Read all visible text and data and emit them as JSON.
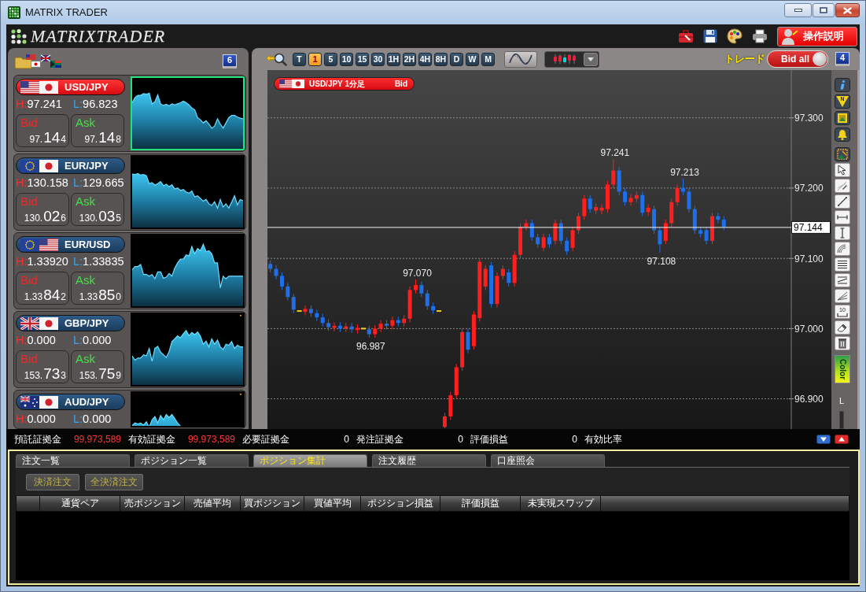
{
  "window": {
    "title": "MATRIX TRADER"
  },
  "app_bar": {
    "logo": "MATRIXTRADER",
    "help_button": "操作説明"
  },
  "rate_panel": {
    "screen_number": "6",
    "pairs": [
      {
        "pair": "USD/JPY",
        "selected": true,
        "high_label": "H:",
        "high": "97.241",
        "low_label": "L:",
        "low": "96.823",
        "bid_label": "Bid",
        "bid": {
          "prefix": "97.",
          "pips": "14",
          "pipette": "4"
        },
        "ask_label": "Ask",
        "ask": {
          "prefix": "97.",
          "pips": "14",
          "pipette": "8"
        }
      },
      {
        "pair": "EUR/JPY",
        "selected": false,
        "high_label": "H:",
        "high": "130.158",
        "low_label": "L:",
        "low": "129.665",
        "bid_label": "Bid",
        "bid": {
          "prefix": "130.",
          "pips": "02",
          "pipette": "6"
        },
        "ask_label": "Ask",
        "ask": {
          "prefix": "130.",
          "pips": "03",
          "pipette": "5"
        }
      },
      {
        "pair": "EUR/USD",
        "selected": false,
        "high_label": "H:",
        "high": "1.33920",
        "low_label": "L:",
        "low": "1.33835",
        "bid_label": "Bid",
        "bid": {
          "prefix": "1.33",
          "pips": "84",
          "pipette": "2"
        },
        "ask_label": "Ask",
        "ask": {
          "prefix": "1.33",
          "pips": "85",
          "pipette": "0"
        }
      },
      {
        "pair": "GBP/JPY",
        "selected": false,
        "high_label": "H:",
        "high": "0.000",
        "low_label": "L:",
        "low": "0.000",
        "bid_label": "Bid",
        "bid": {
          "prefix": "153.",
          "pips": "73",
          "pipette": "3"
        },
        "ask_label": "Ask",
        "ask": {
          "prefix": "153.",
          "pips": "75",
          "pipette": "9"
        }
      },
      {
        "pair": "AUD/JPY",
        "selected": false,
        "high_label": "H:",
        "high": "0.000",
        "low_label": "L:",
        "low": "0.000"
      }
    ]
  },
  "chart_panel": {
    "timeframes": [
      {
        "label": "T",
        "selected": false
      },
      {
        "label": "1",
        "selected": true
      },
      {
        "label": "5",
        "selected": false
      },
      {
        "label": "10",
        "selected": false
      },
      {
        "label": "15",
        "selected": false
      },
      {
        "label": "30",
        "selected": false
      },
      {
        "label": "1H",
        "selected": false
      },
      {
        "label": "2H",
        "selected": false
      },
      {
        "label": "4H",
        "selected": false
      },
      {
        "label": "8H",
        "selected": false
      },
      {
        "label": "D",
        "selected": false
      },
      {
        "label": "W",
        "selected": false
      },
      {
        "label": "M",
        "selected": false
      }
    ],
    "trade_label": "トレード",
    "trade_toggle": {
      "label": "Bid all",
      "on": true
    },
    "screen_number": "4",
    "chart": {
      "title": "USD/JPY 1分足",
      "side": "Bid",
      "chart_data": {
        "type": "candlestick",
        "grid": true,
        "categories": [
          null,
          null,
          null,
          null,
          null,
          null,
          null,
          null,
          null,
          null,
          null,
          null,
          null,
          null,
          null,
          null,
          null,
          null,
          null,
          null,
          null,
          null,
          null,
          null,
          null,
          null,
          null,
          null,
          null,
          null,
          null,
          null,
          null,
          null,
          null,
          null,
          null,
          null,
          null,
          null,
          null,
          null,
          null,
          null,
          null,
          null,
          null,
          null,
          null,
          null,
          null,
          null,
          null,
          null,
          null,
          null,
          null,
          null,
          null,
          null,
          null,
          null,
          null,
          null,
          null,
          null,
          null,
          null,
          null,
          null,
          null,
          null,
          null,
          null,
          null,
          null,
          null,
          null,
          null,
          null,
          null,
          null,
          null,
          null,
          null,
          null,
          null,
          null,
          null,
          null,
          null,
          null,
          null,
          null,
          null,
          null,
          null
        ],
        "ohlc": [
          [
            97.092,
            97.097,
            97.08,
            97.085
          ],
          [
            97.085,
            97.09,
            97.07,
            97.075
          ],
          [
            97.075,
            97.08,
            97.055,
            97.06
          ],
          [
            97.06,
            97.065,
            97.04,
            97.045
          ],
          [
            97.045,
            97.05,
            97.022,
            97.027
          ],
          [
            97.025,
            97.025,
            97.025,
            97.025
          ],
          [
            97.024,
            97.033,
            97.019,
            97.028
          ],
          [
            97.028,
            97.033,
            97.017,
            97.022
          ],
          [
            97.022,
            97.027,
            97.011,
            97.016
          ],
          [
            97.016,
            97.021,
            97.003,
            97.008
          ],
          [
            97.008,
            97.013,
            96.997,
            97.002
          ],
          [
            97.001,
            97.009,
            96.996,
            97.004
          ],
          [
            97.004,
            97.009,
            96.995,
            97.0
          ],
          [
            97.0,
            97.008,
            96.995,
            97.003
          ],
          [
            97.003,
            97.008,
            96.994,
            96.999
          ],
          [
            96.998,
            97.006,
            96.993,
            97.001
          ],
          [
            97.0,
            97.0,
            97.0,
            97.0
          ],
          [
            96.999,
            97.004,
            96.987,
            96.992
          ],
          [
            96.992,
            97.005,
            96.987,
            97.0
          ],
          [
            97.0,
            97.012,
            96.995,
            97.007
          ],
          [
            97.007,
            97.012,
            96.999,
            97.004
          ],
          [
            97.004,
            97.017,
            96.999,
            97.012
          ],
          [
            97.012,
            97.017,
            97.003,
            97.008
          ],
          [
            97.008,
            97.019,
            97.003,
            97.014
          ],
          [
            97.014,
            97.06,
            97.009,
            97.055
          ],
          [
            97.055,
            97.07,
            97.05,
            97.062
          ],
          [
            97.062,
            97.067,
            97.045,
            97.05
          ],
          [
            97.05,
            97.055,
            97.027,
            97.032
          ],
          [
            97.032,
            97.037,
            97.021,
            97.026
          ],
          [
            97.025,
            97.025,
            97.025,
            97.025
          ],
          [
            96.86,
            96.88,
            96.857,
            96.875
          ],
          [
            96.875,
            96.91,
            96.87,
            96.905
          ],
          [
            96.905,
            96.95,
            96.9,
            96.945
          ],
          [
            96.945,
            97.0,
            96.94,
            96.995
          ],
          [
            96.995,
            97.0,
            96.965,
            96.97
          ],
          [
            96.975,
            97.025,
            96.97,
            97.02
          ],
          [
            97.015,
            97.1,
            97.01,
            97.095
          ],
          [
            97.06,
            97.09,
            97.055,
            97.085
          ],
          [
            97.09,
            97.095,
            97.03,
            97.035
          ],
          [
            97.035,
            97.08,
            97.03,
            97.075
          ],
          [
            97.075,
            97.09,
            97.07,
            97.085
          ],
          [
            97.08,
            97.085,
            97.06,
            97.065
          ],
          [
            97.065,
            97.11,
            97.06,
            97.105
          ],
          [
            97.105,
            97.15,
            97.1,
            97.145
          ],
          [
            97.145,
            97.155,
            97.14,
            97.15
          ],
          [
            97.15,
            97.155,
            97.125,
            97.13
          ],
          [
            97.13,
            97.135,
            97.115,
            97.12
          ],
          [
            97.115,
            97.135,
            97.11,
            97.13
          ],
          [
            97.13,
            97.135,
            97.115,
            97.12
          ],
          [
            97.125,
            97.155,
            97.12,
            97.15
          ],
          [
            97.15,
            97.155,
            97.12,
            97.125
          ],
          [
            97.125,
            97.13,
            97.105,
            97.11
          ],
          [
            97.115,
            97.145,
            97.11,
            97.14
          ],
          [
            97.14,
            97.165,
            97.135,
            97.16
          ],
          [
            97.16,
            97.19,
            97.155,
            97.185
          ],
          [
            97.185,
            97.19,
            97.165,
            97.17
          ],
          [
            97.168,
            97.178,
            97.163,
            97.173
          ],
          [
            97.168,
            97.177,
            97.163,
            97.172
          ],
          [
            97.17,
            97.21,
            97.165,
            97.205
          ],
          [
            97.205,
            97.241,
            97.2,
            97.225
          ],
          [
            97.225,
            97.23,
            97.19,
            97.195
          ],
          [
            97.195,
            97.2,
            97.175,
            97.18
          ],
          [
            97.18,
            97.191,
            97.175,
            97.186
          ],
          [
            97.185,
            97.195,
            97.18,
            97.19
          ],
          [
            97.19,
            97.195,
            97.16,
            97.165
          ],
          [
            97.166,
            97.177,
            97.161,
            97.172
          ],
          [
            97.17,
            97.175,
            97.135,
            97.14
          ],
          [
            97.14,
            97.145,
            97.108,
            97.12
          ],
          [
            97.125,
            97.155,
            97.12,
            97.15
          ],
          [
            97.15,
            97.185,
            97.145,
            97.18
          ],
          [
            97.18,
            97.205,
            97.175,
            97.2
          ],
          [
            97.2,
            97.213,
            97.19,
            97.195
          ],
          [
            97.195,
            97.2,
            97.165,
            97.17
          ],
          [
            97.17,
            97.175,
            97.135,
            97.14
          ],
          [
            97.14,
            97.145,
            97.13,
            97.135
          ],
          [
            97.14,
            97.145,
            97.12,
            97.125
          ],
          [
            97.125,
            97.165,
            97.12,
            97.16
          ],
          [
            97.16,
            97.165,
            97.15,
            97.155
          ],
          [
            97.155,
            97.16,
            97.14,
            97.145
          ],
          null,
          null,
          null,
          null,
          null,
          null,
          null,
          null,
          null,
          null,
          null,
          null,
          null,
          null,
          null,
          null,
          null,
          null
        ],
        "ylim": [
          96.857,
          97.368
        ],
        "yticks": [
          {
            "value": 97.3,
            "label": "97.300"
          },
          {
            "value": 97.2,
            "label": "97.200"
          },
          {
            "value": 97.1,
            "label": "97.100"
          },
          {
            "value": 97.0,
            "label": "97.000"
          },
          {
            "value": 96.9,
            "label": "96.900"
          }
        ],
        "ref_lines": [
          {
            "axis": "y",
            "value": 97.144,
            "label": "97.144"
          }
        ],
        "annotations": [
          "97.241",
          "97.213",
          "97.108",
          "97.070",
          "96.987"
        ]
      }
    },
    "side_toolbar": {
      "news_label": "N",
      "measure_label": "10",
      "color_label": "Color",
      "scale_label": "L"
    }
  },
  "status_bar": {
    "items": [
      {
        "label": "預託証拠金",
        "value": "99,973,589",
        "color": "#ff3535"
      },
      {
        "label": "有効証拠金",
        "value": "99,973,589",
        "color": "#ff3535"
      },
      {
        "label": "必要証拠金",
        "value": "0"
      },
      {
        "label": "発注証拠金",
        "value": "0"
      },
      {
        "label": "評価損益",
        "value": "0"
      },
      {
        "label": "有効比率"
      }
    ]
  },
  "bottom_panel": {
    "tabs": [
      {
        "label": "注文一覧",
        "selected": false
      },
      {
        "label": "ポジション一覧",
        "selected": false
      },
      {
        "label": "ポジション集計",
        "selected": true
      },
      {
        "label": "注文履歴",
        "selected": false
      },
      {
        "label": "口座照会",
        "selected": false
      }
    ],
    "buttons": [
      {
        "label": "決済注文",
        "disabled": true
      },
      {
        "label": "全決済注文",
        "disabled": true
      }
    ],
    "table": {
      "columns": [
        "通貨ペア",
        "売ポジション",
        "売値平均",
        "買ポジション",
        "買値平均",
        "ポジション損益",
        "評価損益",
        "未実現スワップ"
      ]
    }
  }
}
